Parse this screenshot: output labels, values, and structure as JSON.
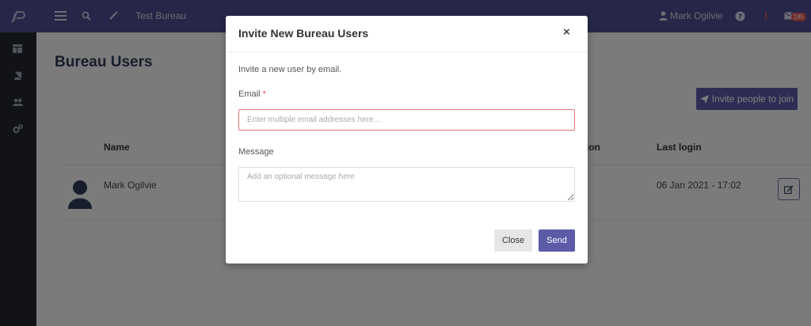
{
  "header": {
    "bureau_name": "Test Bureau",
    "user_name": "Mark Ogilvie",
    "notification_count": "185"
  },
  "page": {
    "title": "Bureau Users",
    "invite_button_label": "Invite people to join"
  },
  "table": {
    "columns": [
      "Name",
      "tion",
      "Last login"
    ],
    "rows": [
      {
        "name": "Mark Ogilvie",
        "last_login": "06 Jan 2021 - 17:02"
      }
    ]
  },
  "modal": {
    "title": "Invite New Bureau Users",
    "close_symbol": "×",
    "intro": "Invite a new user by email.",
    "email_label": "Email",
    "required_mark": "*",
    "email_placeholder": "Enter multiple email addresses here...",
    "email_value": "",
    "message_label": "Message",
    "message_placeholder": "Add an optional message here",
    "message_value": "",
    "close_button": "Close",
    "send_button": "Send"
  },
  "colors": {
    "topbar": "#4d4d91",
    "sidebar": "#23262f",
    "accent": "#5b5ba8",
    "error_border": "#e57373"
  },
  "icons": {
    "brand": "brand-logo-icon",
    "menu": "hamburger-icon",
    "search": "search-icon",
    "edit_wand": "pencil-icon",
    "user": "user-icon",
    "help": "question-circle-icon",
    "alert": "alert-icon",
    "mail": "envelope-icon",
    "sidebar": [
      "dashboard-icon",
      "book-icon",
      "users-icon",
      "gears-icon"
    ],
    "invite": "paper-plane-icon",
    "row_edit": "edit-icon"
  }
}
